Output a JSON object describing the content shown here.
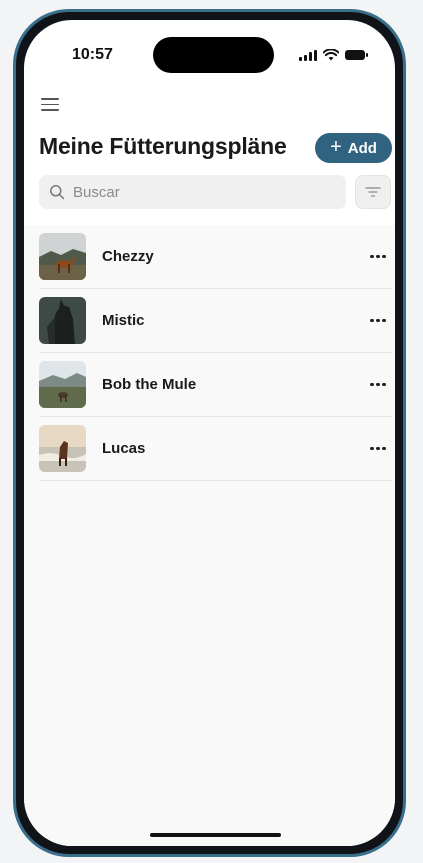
{
  "status_bar": {
    "time": "10:57"
  },
  "header": {
    "title": "Meine Fütterungspläne",
    "add_label": "Add",
    "add_icon": "plus-icon"
  },
  "search": {
    "placeholder": "Buscar",
    "value": ""
  },
  "horses": [
    {
      "name": "Chezzy"
    },
    {
      "name": "Mistic"
    },
    {
      "name": "Bob the Mule"
    },
    {
      "name": "Lucas"
    }
  ],
  "colors": {
    "accent": "#2f6380",
    "phone_frame": "#3a6f8c",
    "list_bg": "#f9f9f9"
  }
}
